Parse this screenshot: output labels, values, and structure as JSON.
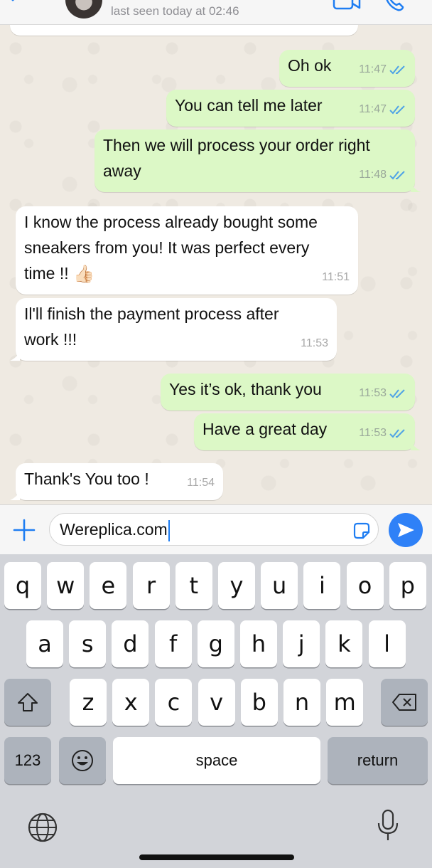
{
  "header": {
    "last_seen": "last seen today at 02:46"
  },
  "chat": {
    "messages": [
      {
        "dir": "out",
        "text": "Oh ok",
        "time": "11:47",
        "read": true
      },
      {
        "dir": "out",
        "text": "You can tell me later",
        "time": "11:47",
        "read": true
      },
      {
        "dir": "out",
        "text": "Then we will process your order right\naway",
        "time": "11:48",
        "read": true
      },
      {
        "dir": "in",
        "text": "I know the process already bought some\nsneakers from you! It was perfect every\ntime !!",
        "emoji": "👍🏻",
        "time": "11:51"
      },
      {
        "dir": "in",
        "text": "Il'll finish the payment process after\nwork !!!",
        "time": "11:53"
      },
      {
        "dir": "out",
        "text": "Yes it’s ok, thank you",
        "time": "11:53",
        "read": true
      },
      {
        "dir": "out",
        "text": "Have a great day",
        "time": "11:53",
        "read": true
      },
      {
        "dir": "in",
        "text": "Thank's You too !",
        "time": "11:54"
      }
    ]
  },
  "composer": {
    "input_value": "Wereplica.com"
  },
  "keyboard": {
    "row1": [
      "q",
      "w",
      "e",
      "r",
      "t",
      "y",
      "u",
      "i",
      "o",
      "p"
    ],
    "row2": [
      "a",
      "s",
      "d",
      "f",
      "g",
      "h",
      "j",
      "k",
      "l"
    ],
    "row3": [
      "z",
      "x",
      "c",
      "v",
      "b",
      "n",
      "m"
    ],
    "numbers_key": "123",
    "space_key": "space",
    "return_key": "return"
  },
  "colors": {
    "outgoing_bubble": "#dcf8c6",
    "incoming_bubble": "#ffffff",
    "accent_blue": "#2f81f7",
    "read_ticks": "#4fa3e6"
  }
}
